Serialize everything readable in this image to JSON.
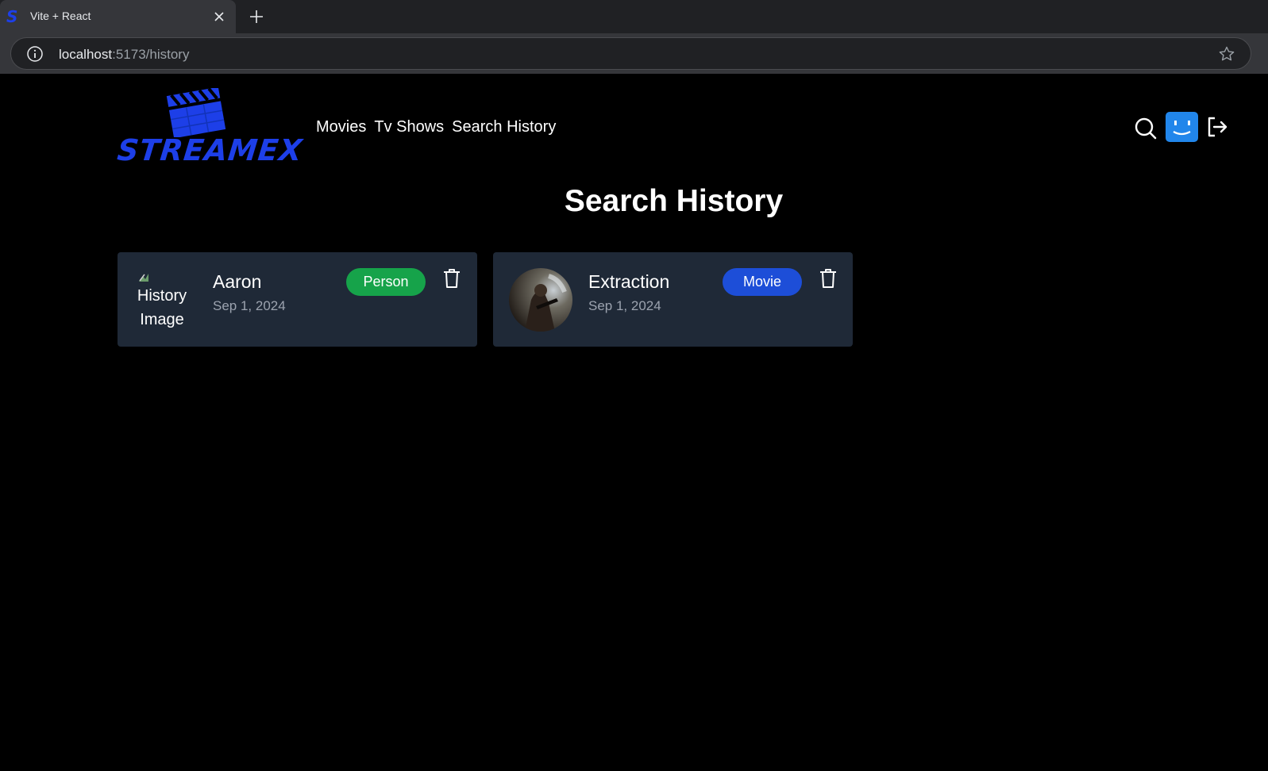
{
  "browser": {
    "tab_title": "Vite + React",
    "url_host": "localhost",
    "url_path": ":5173/history"
  },
  "header": {
    "logo_text": "STREAMEX",
    "nav": [
      "Movies",
      "Tv Shows",
      "Search History"
    ]
  },
  "page": {
    "title": "Search History"
  },
  "history": [
    {
      "title": "Aaron",
      "date": "Sep 1, 2024",
      "type": "Person",
      "type_color": "#16a34a",
      "image_alt": "History Image",
      "image_broken": true
    },
    {
      "title": "Extraction",
      "date": "Sep 1, 2024",
      "type": "Movie",
      "type_color": "#1d4ed8",
      "image_broken": false
    }
  ],
  "colors": {
    "brand": "#1d3fe8",
    "card_bg": "#1f2937",
    "avatar_bg": "#2186eb"
  },
  "icons": {
    "tab_favicon": "streamex-s-icon",
    "site_info": "info-icon",
    "bookmark": "star-icon",
    "search": "search-icon",
    "avatar": "smiley-avatar-icon",
    "logout": "logout-icon",
    "delete": "trash-icon"
  }
}
